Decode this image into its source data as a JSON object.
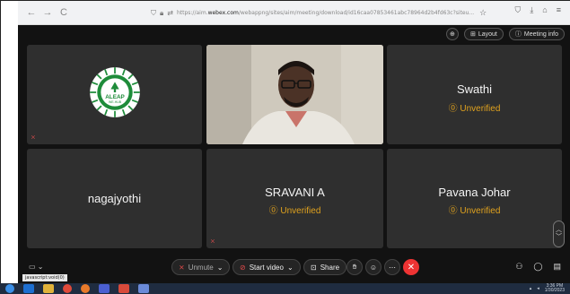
{
  "browser": {
    "back": "←",
    "forward": "→",
    "reload": "C",
    "url_prefix": "https://aim.",
    "url_domain": "webex.com",
    "url_rest": "/webappng/sites/aim/meeting/download/id16caa07853461abc78964d2b4fd63c?siteu...",
    "star": "☆"
  },
  "topbar": {
    "layout_label": "Layout",
    "info_label": "Meeting info"
  },
  "tiles": [
    {
      "name": "",
      "status": "",
      "logo_text": "ALEAP",
      "logo_subtext": "WE-HUB"
    },
    {
      "name": "",
      "status": ""
    },
    {
      "name": "Swathi",
      "status": "Unverified"
    },
    {
      "name": "nagajyothi",
      "status": ""
    },
    {
      "name": "SRAVANI A",
      "status": "Unverified"
    },
    {
      "name": "Pavana Johar",
      "status": "Unverified"
    }
  ],
  "controls": {
    "unmute_label": "Unmute",
    "start_video_label": "Start video",
    "share_label": "Share"
  },
  "status_tooltip": "javascript:void(0)",
  "tray": {
    "time": "3:36 PM",
    "date": "1/30/2023"
  },
  "colors": {
    "meeting_bg": "#121212",
    "tile_bg": "#2f2f2f",
    "unverified": "#e0a21e",
    "end_call": "#e33333",
    "taskbar": "#1f2c40",
    "logo_green": "#1e8c3a"
  }
}
